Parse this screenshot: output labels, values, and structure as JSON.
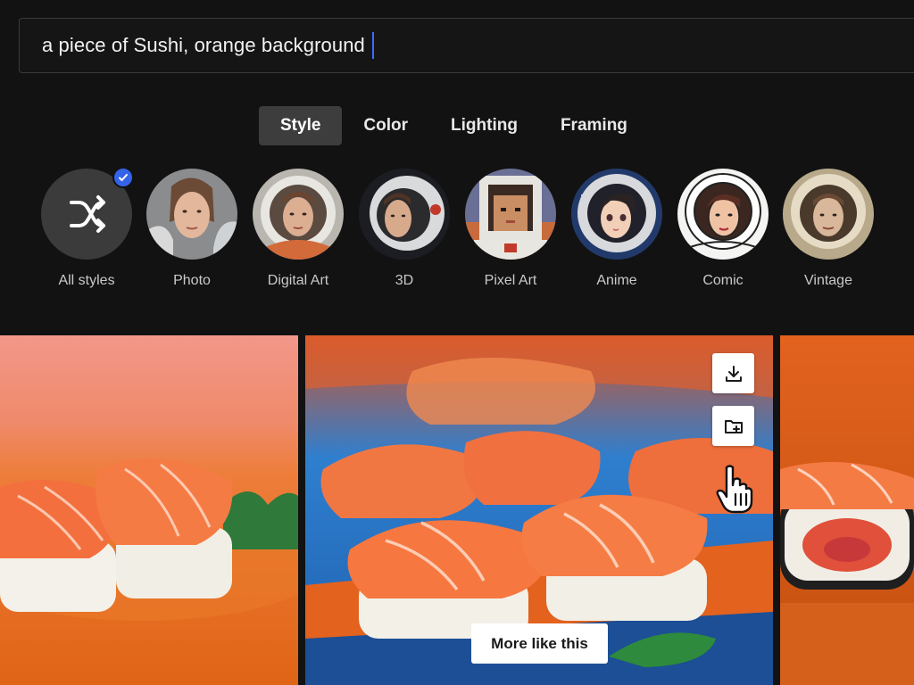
{
  "prompt": {
    "value": "a piece of Sushi, orange background"
  },
  "tabs": [
    {
      "label": "Style",
      "active": true
    },
    {
      "label": "Color",
      "active": false
    },
    {
      "label": "Lighting",
      "active": false
    },
    {
      "label": "Framing",
      "active": false
    }
  ],
  "styles": [
    {
      "label": "All styles",
      "icon": "shuffle-icon",
      "selected": true
    },
    {
      "label": "Photo"
    },
    {
      "label": "Digital Art"
    },
    {
      "label": "3D"
    },
    {
      "label": "Pixel Art"
    },
    {
      "label": "Anime"
    },
    {
      "label": "Comic"
    },
    {
      "label": "Vintage"
    }
  ],
  "actions": {
    "download_icon": "download-icon",
    "save_icon": "folder-add-icon",
    "more_label": "More like this"
  },
  "colors": {
    "accent": "#3563e9",
    "background": "#121212",
    "active_tab": "#3d3d3d"
  }
}
